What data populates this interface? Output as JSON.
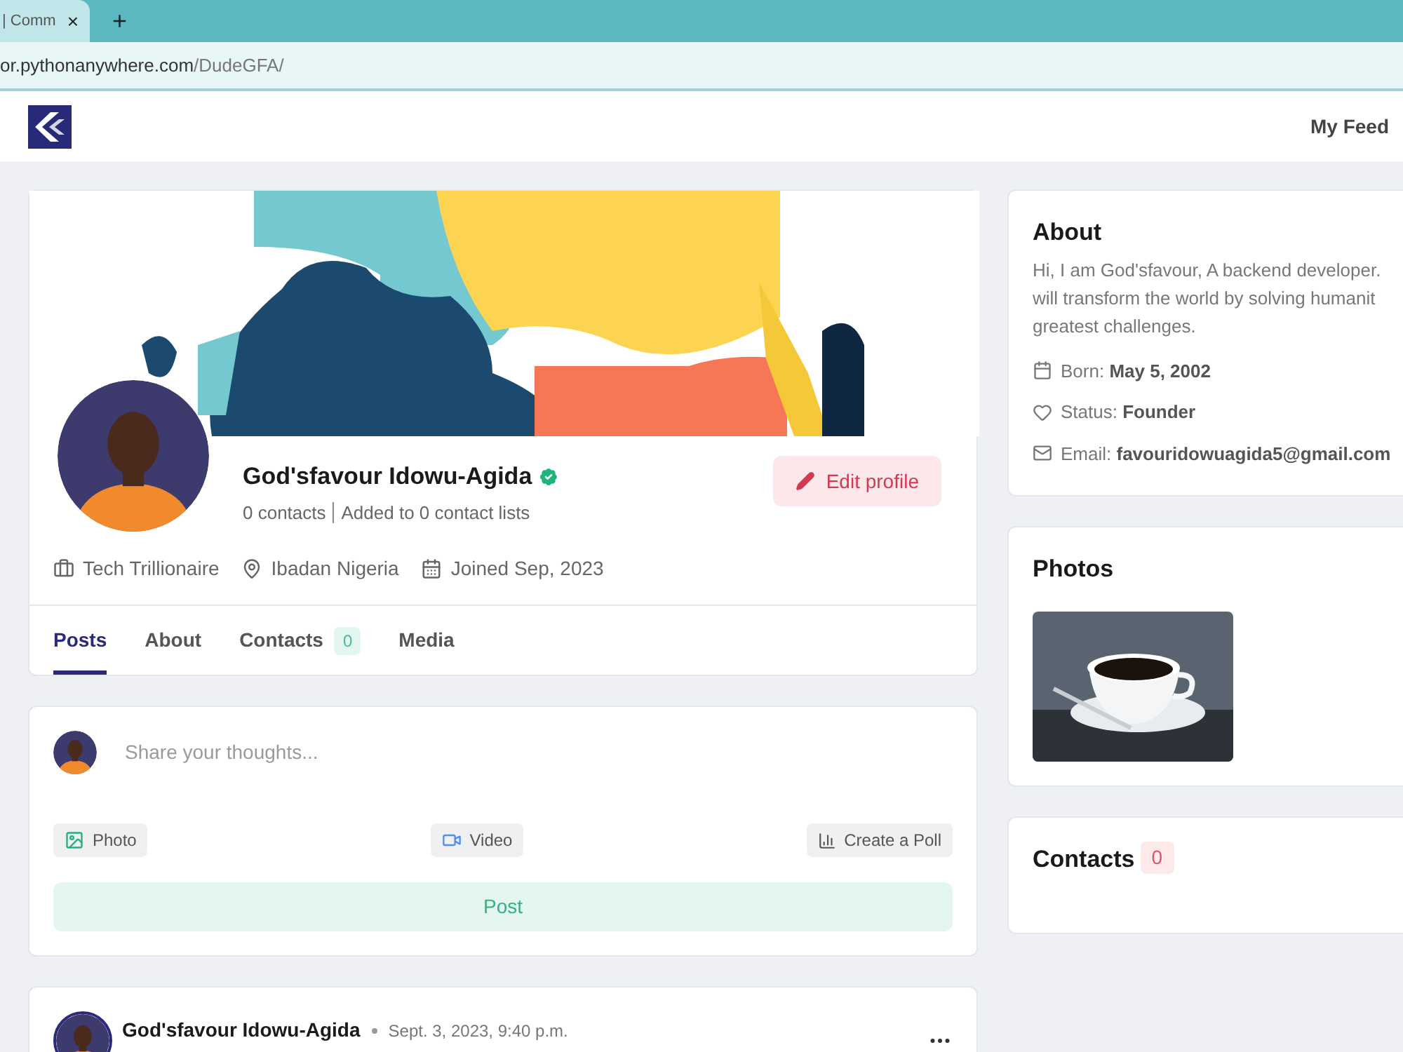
{
  "browser": {
    "tab_title": "| Comm",
    "close": "×",
    "new_tab": "+",
    "url_host": "or.pythonanywhere.com",
    "url_path": "/DudeGFA/"
  },
  "navbar": {
    "feed_link": "My Feed"
  },
  "profile": {
    "name": "God'sfavour Idowu-Agida",
    "stats": [
      "0 contacts",
      "Added to 0 contact lists"
    ],
    "edit_button": "Edit profile",
    "meta": [
      {
        "kind": "work",
        "text": "Tech Trillionaire"
      },
      {
        "kind": "location",
        "text": "Ibadan Nigeria"
      },
      {
        "kind": "joined",
        "text": "Joined Sep, 2023"
      }
    ],
    "tabs": [
      {
        "label": "Posts",
        "selected": true
      },
      {
        "label": "About",
        "selected": false
      },
      {
        "label": "Contacts",
        "selected": false,
        "count": "0"
      },
      {
        "label": "Media",
        "selected": false
      }
    ]
  },
  "composer": {
    "placeholder": "Share your thoughts...",
    "actions": [
      {
        "label": "Photo"
      },
      {
        "kind": "video",
        "label": "Video"
      },
      {
        "kind": "poll",
        "label": "Create a Poll"
      }
    ],
    "post_button": "Post"
  },
  "post": {
    "author": "God'sfavour Idowu-Agida",
    "date": "Sept. 3, 2023, 9:40 p.m."
  },
  "about": {
    "title": "About",
    "bio_lines": [
      "Hi, I am God'sfavour, A backend developer.",
      "will transform the world by solving humanit",
      "greatest challenges."
    ],
    "facts": [
      {
        "kind": "born",
        "label": "Born:",
        "value": "May 5, 2002"
      },
      {
        "kind": "status",
        "label": "Status:",
        "value": "Founder"
      },
      {
        "kind": "email",
        "label": "Email:",
        "value": "favouridowuagida5@gmail.com"
      }
    ]
  },
  "photos": {
    "title": "Photos"
  },
  "contacts": {
    "title": "Contacts",
    "count": "0"
  }
}
